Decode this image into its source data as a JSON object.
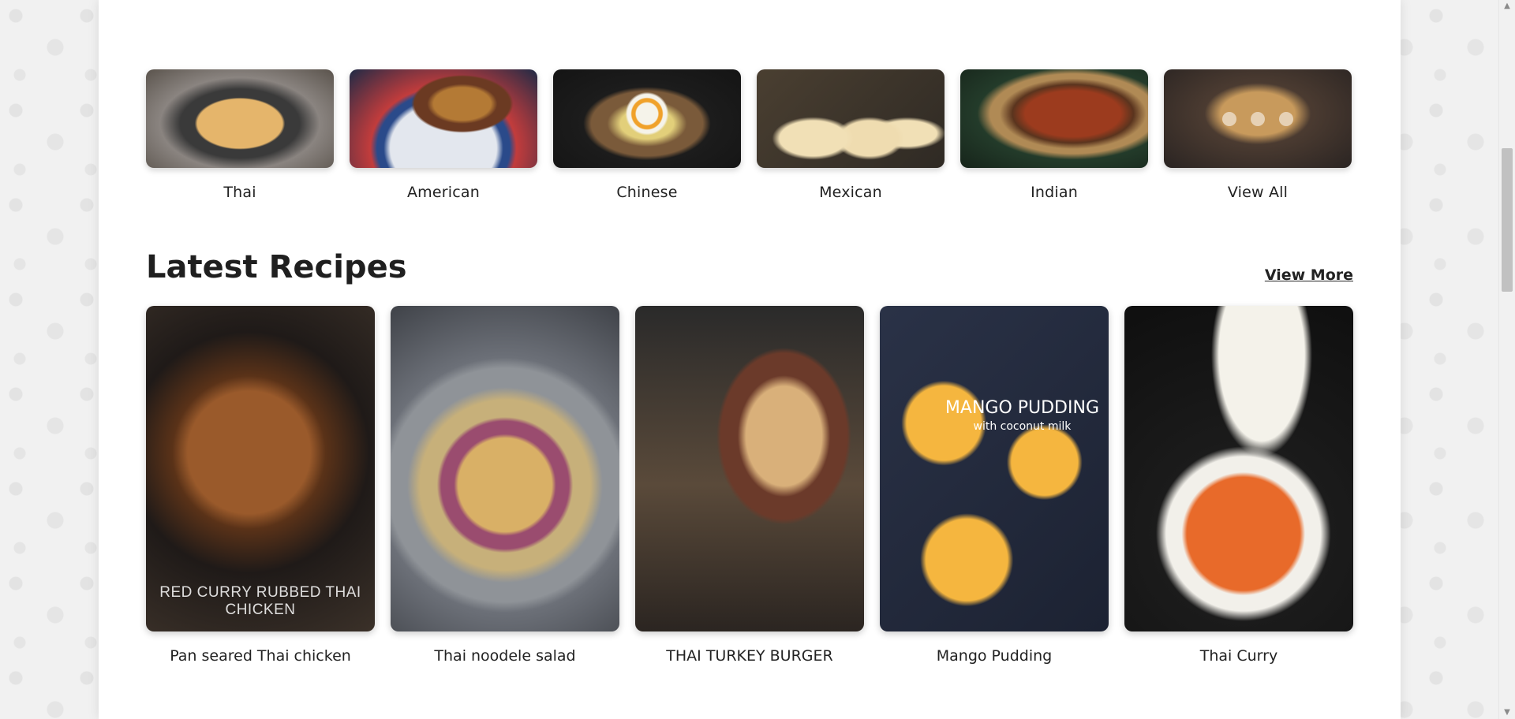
{
  "categories": [
    {
      "label": "Thai"
    },
    {
      "label": "American"
    },
    {
      "label": "Chinese"
    },
    {
      "label": "Mexican"
    },
    {
      "label": "Indian"
    },
    {
      "label": "View All"
    }
  ],
  "latest": {
    "title": "Latest Recipes",
    "view_more": "View More",
    "recipes": [
      {
        "label": "Pan seared Thai chicken",
        "image_text": "RED CURRY RUBBED THAI CHICKEN"
      },
      {
        "label": "Thai noodele salad"
      },
      {
        "label": "THAI TURKEY BURGER"
      },
      {
        "label": "Mango Pudding",
        "image_title": "MANGO PUDDING",
        "image_subtitle": "with coconut milk"
      },
      {
        "label": "Thai Curry"
      }
    ]
  },
  "colors": {
    "thai": "#6b5a4c",
    "american": "#8b6a46",
    "chinese": "#2c2622",
    "mexican": "#4c4236",
    "indian": "#5a3226",
    "view_all": "#3b2d2b"
  }
}
